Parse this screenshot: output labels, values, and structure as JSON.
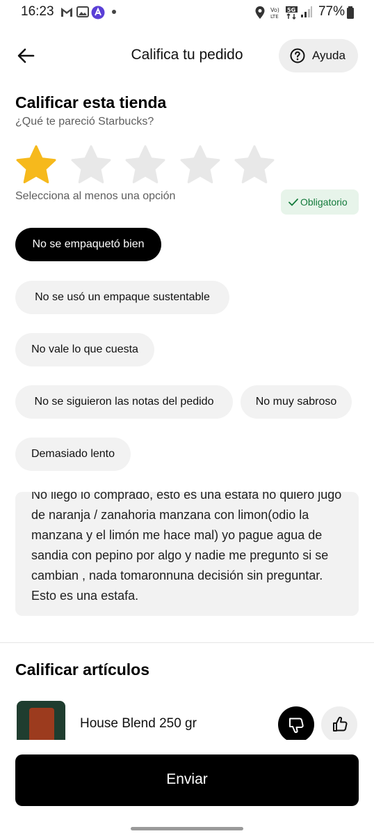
{
  "status_bar": {
    "time": "16:23",
    "battery_text": "77%",
    "left_icons": [
      "gmail-icon",
      "photo-icon",
      "app-notification-icon",
      "dot-icon"
    ],
    "right_icons": [
      "location-icon",
      "volte-icon",
      "5g-icon",
      "signal-icon",
      "battery-icon"
    ]
  },
  "header": {
    "title": "Califica tu pedido",
    "help_label": "Ayuda"
  },
  "store_rating": {
    "title": "Calificar esta tienda",
    "subtitle": "¿Qué te pareció Starbucks?",
    "rating": 1,
    "max_rating": 5,
    "hint": "Selecciona al menos una opción",
    "required_label": "Obligatorio",
    "colors": {
      "star_active": "#F6B91C",
      "star_inactive": "#E8E8E8",
      "required_green": "#137A3B"
    }
  },
  "chips": [
    {
      "label": "No se empaquetó bien",
      "selected": true
    },
    {
      "label": "No se usó un empaque sustentable",
      "selected": false
    },
    {
      "label": "No vale lo que cuesta",
      "selected": false
    },
    {
      "label": "No se siguieron las notas del pedido",
      "selected": false
    },
    {
      "label": "No muy sabroso",
      "selected": false
    },
    {
      "label": "Demasiado lento",
      "selected": false
    }
  ],
  "comment": {
    "text": "No llego lo comprado, esto es una estafa no quiero jugo de naranja / zanahoria manzana con limon(odio la manzana y el limón me hace mal) yo pague agua de sandia con pepino por algo y nadie me pregunto si se cambian , nada tomaronnuna decisión sin preguntar. Esto es una estafa."
  },
  "items_section": {
    "title": "Calificar artículos",
    "items": [
      {
        "name": "House Blend 250 gr",
        "feedback": "dislike"
      }
    ]
  },
  "submit_label": "Enviar"
}
